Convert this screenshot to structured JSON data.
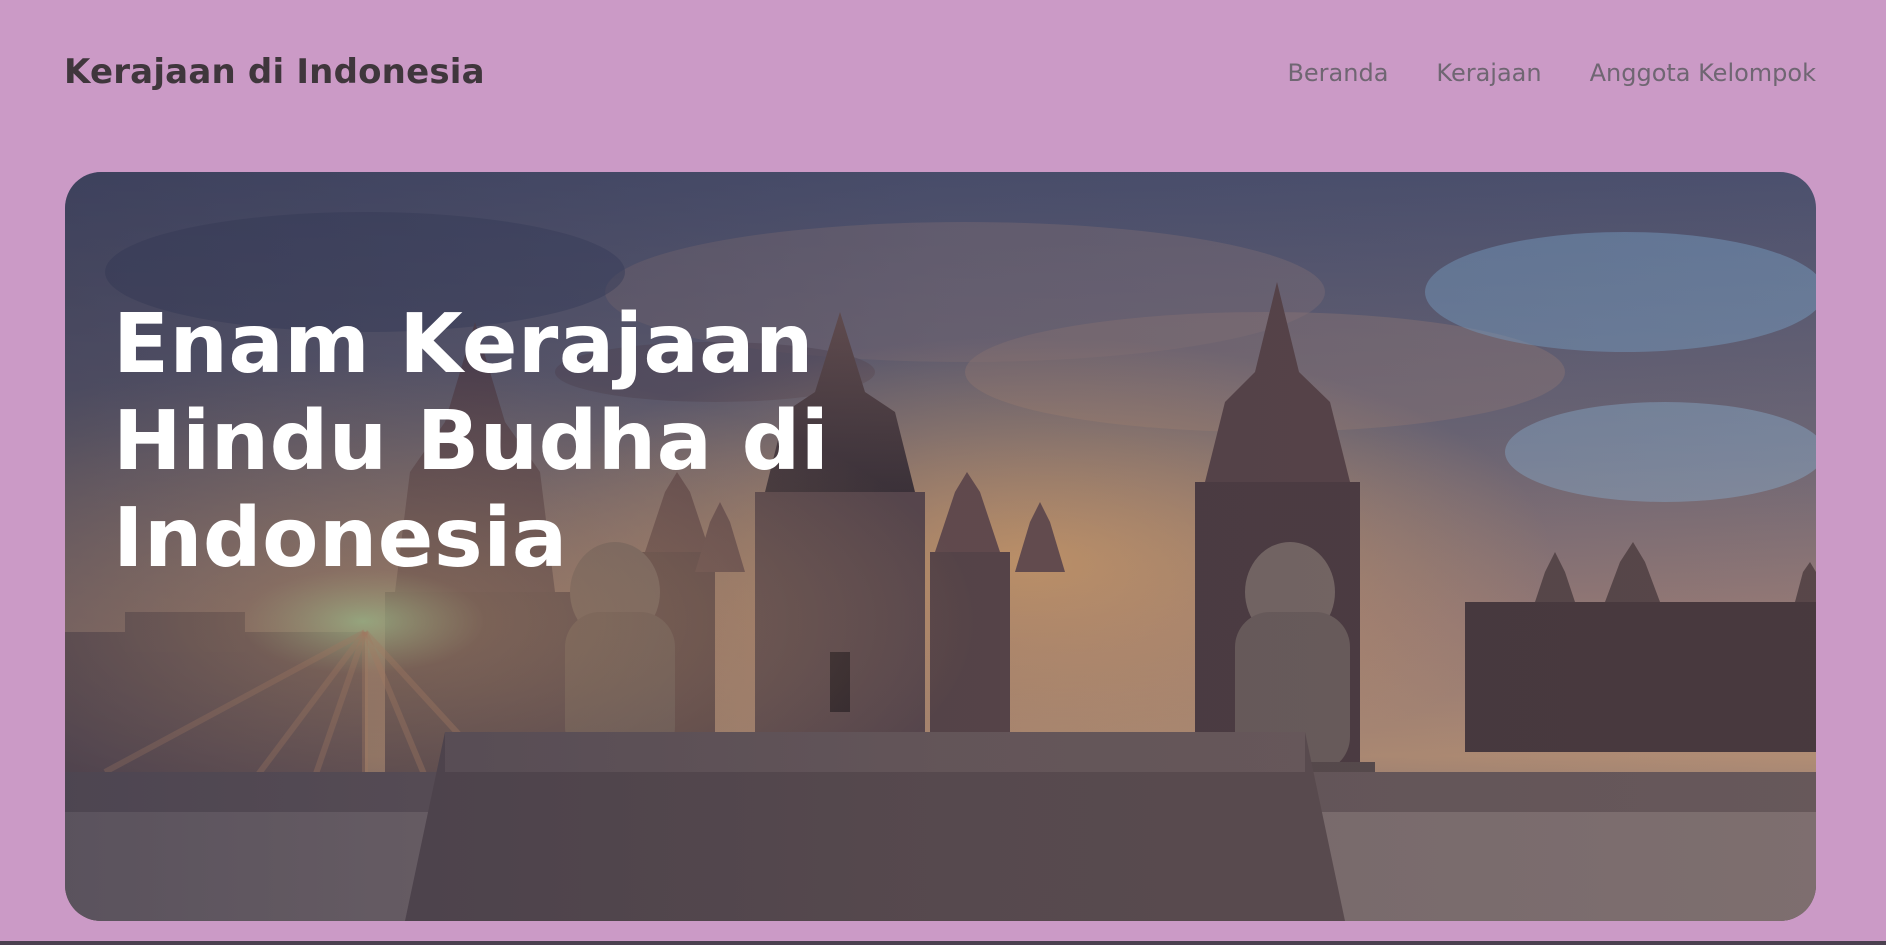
{
  "header": {
    "brand": "Kerajaan di Indonesia",
    "nav": [
      {
        "label": "Beranda"
      },
      {
        "label": "Kerajaan"
      },
      {
        "label": "Anggota Kelompok"
      }
    ]
  },
  "hero": {
    "title_lines": [
      "Enam Kerajaan",
      "Hindu Budha di",
      "Indonesia"
    ],
    "background_image": "temple-complex-sunset-photo"
  },
  "colors": {
    "page_background": "#cb9ac6",
    "brand_text": "#3f363c",
    "nav_text": "#6f6672",
    "hero_text": "#ffffff"
  }
}
